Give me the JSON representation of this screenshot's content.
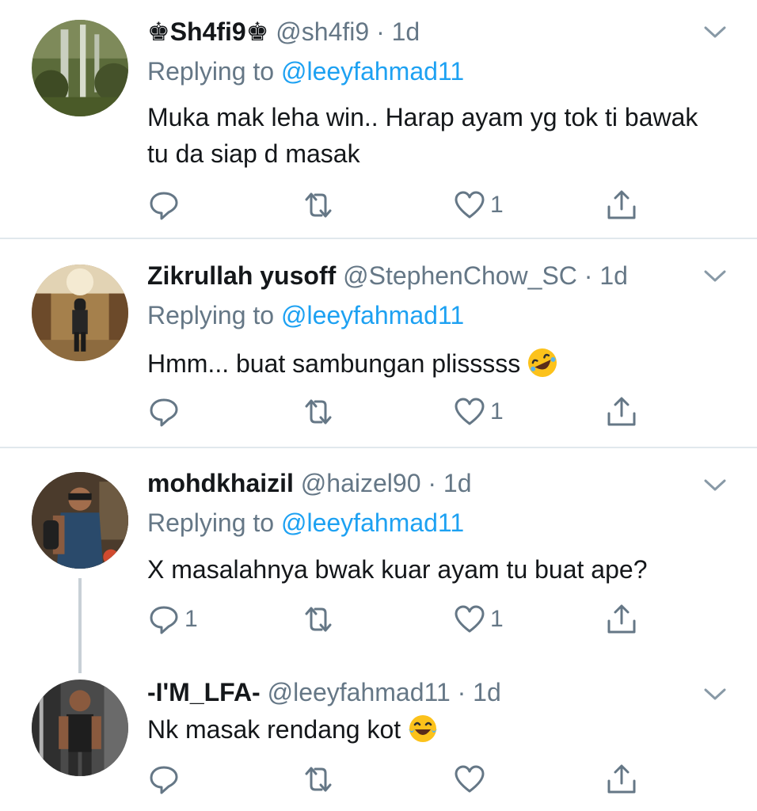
{
  "tweets": [
    {
      "name": "♚Sh4fi9♚",
      "handle": "@sh4fi9",
      "dot": "·",
      "time": "1d",
      "reply_prefix": "Replying to",
      "reply_to": "@leeyfahmad11",
      "text": "Muka mak leha win.. Harap ayam yg tok ti bawak tu da siap d masak",
      "reply_count": "",
      "retweet_count": "",
      "like_count": "1"
    },
    {
      "name": "Zikrullah yusoff",
      "handle": "@StephenChow_SC",
      "dot": "·",
      "time": "1d",
      "reply_prefix": "Replying to",
      "reply_to": "@leeyfahmad11",
      "text": "Hmm... buat sambungan plisssss",
      "emoji": "rofl-emoji",
      "reply_count": "",
      "retweet_count": "",
      "like_count": "1"
    },
    {
      "name": "mohdkhaizil",
      "handle": "@haizel90",
      "dot": "·",
      "time": "1d",
      "reply_prefix": "Replying to",
      "reply_to": "@leeyfahmad11",
      "text": "X masalahnya bwak kuar ayam tu buat ape?",
      "reply_count": "1",
      "retweet_count": "",
      "like_count": "1"
    },
    {
      "name": "-I'M_LFA-",
      "handle": "@leeyfahmad11",
      "dot": "·",
      "time": "1d",
      "text": "Nk masak rendang kot",
      "emoji": "tears-of-joy-emoji",
      "reply_count": "",
      "retweet_count": "",
      "like_count": ""
    }
  ],
  "colors": {
    "link": "#1da1f2",
    "secondary": "#657786",
    "divider": "#e1e8ed",
    "thread_line": "#c8d0d6"
  }
}
